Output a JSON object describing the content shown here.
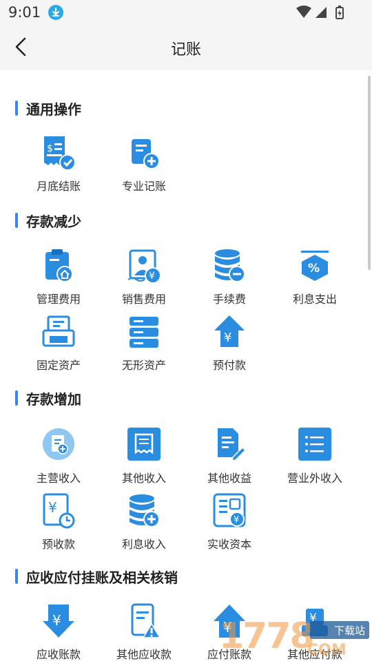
{
  "status": {
    "time": "9:01"
  },
  "header": {
    "title": "记账"
  },
  "sections": [
    {
      "title": "通用操作",
      "items": [
        {
          "label": "月底结账",
          "icon": "receipt-check-icon"
        },
        {
          "label": "专业记账",
          "icon": "doc-add-icon"
        }
      ]
    },
    {
      "title": "存款减少",
      "items": [
        {
          "label": "管理费用",
          "icon": "clipboard-home-icon"
        },
        {
          "label": "销售费用",
          "icon": "salesperson-yen-icon"
        },
        {
          "label": "手续费",
          "icon": "coins-minus-icon"
        },
        {
          "label": "利息支出",
          "icon": "percent-hexagon-icon"
        },
        {
          "label": "固定资产",
          "icon": "printer-icon"
        },
        {
          "label": "无形资产",
          "icon": "server-stack-icon"
        },
        {
          "label": "预付款",
          "icon": "house-yen-icon"
        }
      ]
    },
    {
      "title": "存款增加",
      "items": [
        {
          "label": "主营收入",
          "icon": "circle-doc-add-icon"
        },
        {
          "label": "其他收入",
          "icon": "receipt-square-icon"
        },
        {
          "label": "其他收益",
          "icon": "doc-edit-icon"
        },
        {
          "label": "营业外收入",
          "icon": "list-square-icon"
        },
        {
          "label": "预收款",
          "icon": "yen-clock-icon"
        },
        {
          "label": "利息收入",
          "icon": "coins-add-icon"
        },
        {
          "label": "实收资本",
          "icon": "form-yen-icon"
        }
      ]
    },
    {
      "title": "应收应付挂账及相关核销",
      "items": [
        {
          "label": "应收账款",
          "icon": "yen-arrow-down-icon"
        },
        {
          "label": "其他应收款",
          "icon": "doc-warning-icon"
        },
        {
          "label": "应付账款",
          "icon": "yen-arrow-up-icon"
        },
        {
          "label": "其他应付款",
          "icon": "yen-box-icon"
        }
      ]
    }
  ],
  "watermark": {
    "number": "1778",
    "badge": "下载站",
    "suffix": "COM"
  },
  "colors": {
    "primary": "#2a8de0",
    "accent": "#3a86e8",
    "light": "#8fc6f2"
  }
}
